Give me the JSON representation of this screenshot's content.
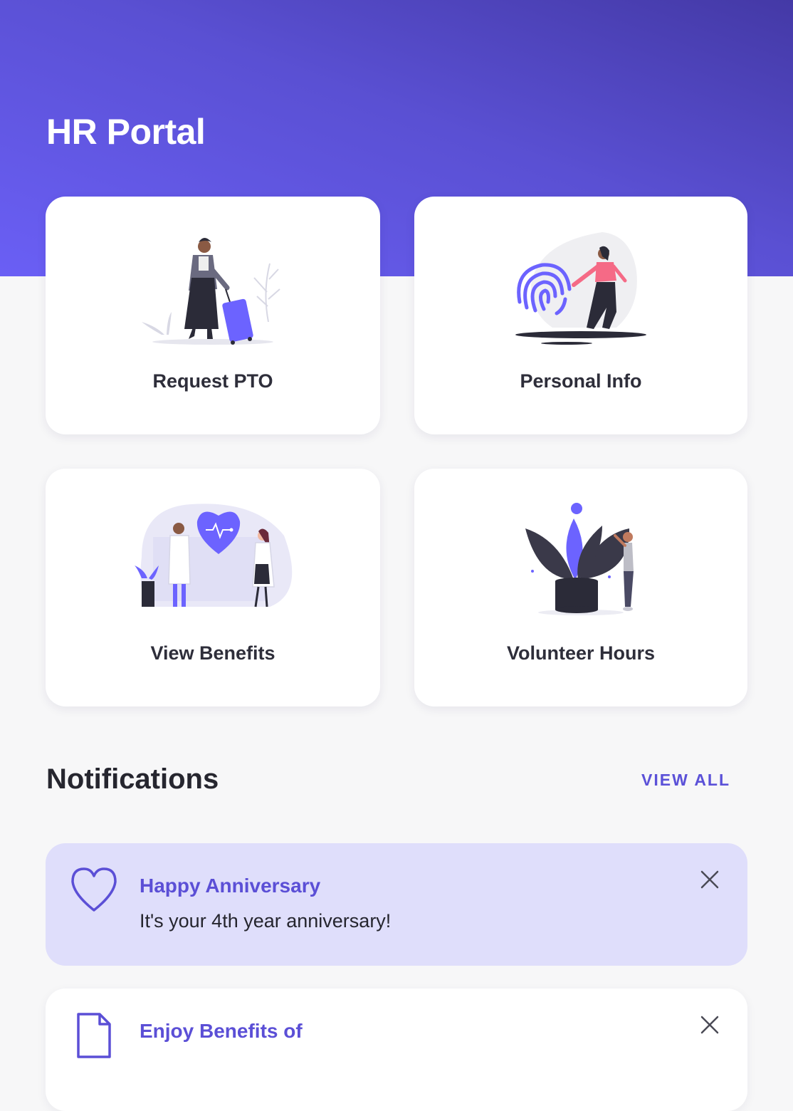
{
  "header": {
    "title": "HR Portal"
  },
  "tiles": [
    {
      "label": "Request PTO",
      "illustration": "traveler-with-suitcase-illustration"
    },
    {
      "label": "Personal Info",
      "illustration": "fingerprint-illustration"
    },
    {
      "label": "View Benefits",
      "illustration": "doctors-heart-illustration"
    },
    {
      "label": "Volunteer Hours",
      "illustration": "plant-pot-illustration"
    }
  ],
  "notifications": {
    "title": "Notifications",
    "view_all_label": "VIEW ALL",
    "items": [
      {
        "title": "Happy Anniversary",
        "body": "It's your 4th year anniversary!",
        "icon": "heart-icon"
      },
      {
        "title": "Enjoy Benefits of",
        "body": "",
        "icon": "document-icon"
      }
    ]
  },
  "colors": {
    "header_gradient_start": "#6a5ff5",
    "header_gradient_end": "#4439a6",
    "accent": "#5b51d8",
    "notification_highlight_bg": "#dfdefb",
    "page_bg": "#f7f7f8"
  }
}
